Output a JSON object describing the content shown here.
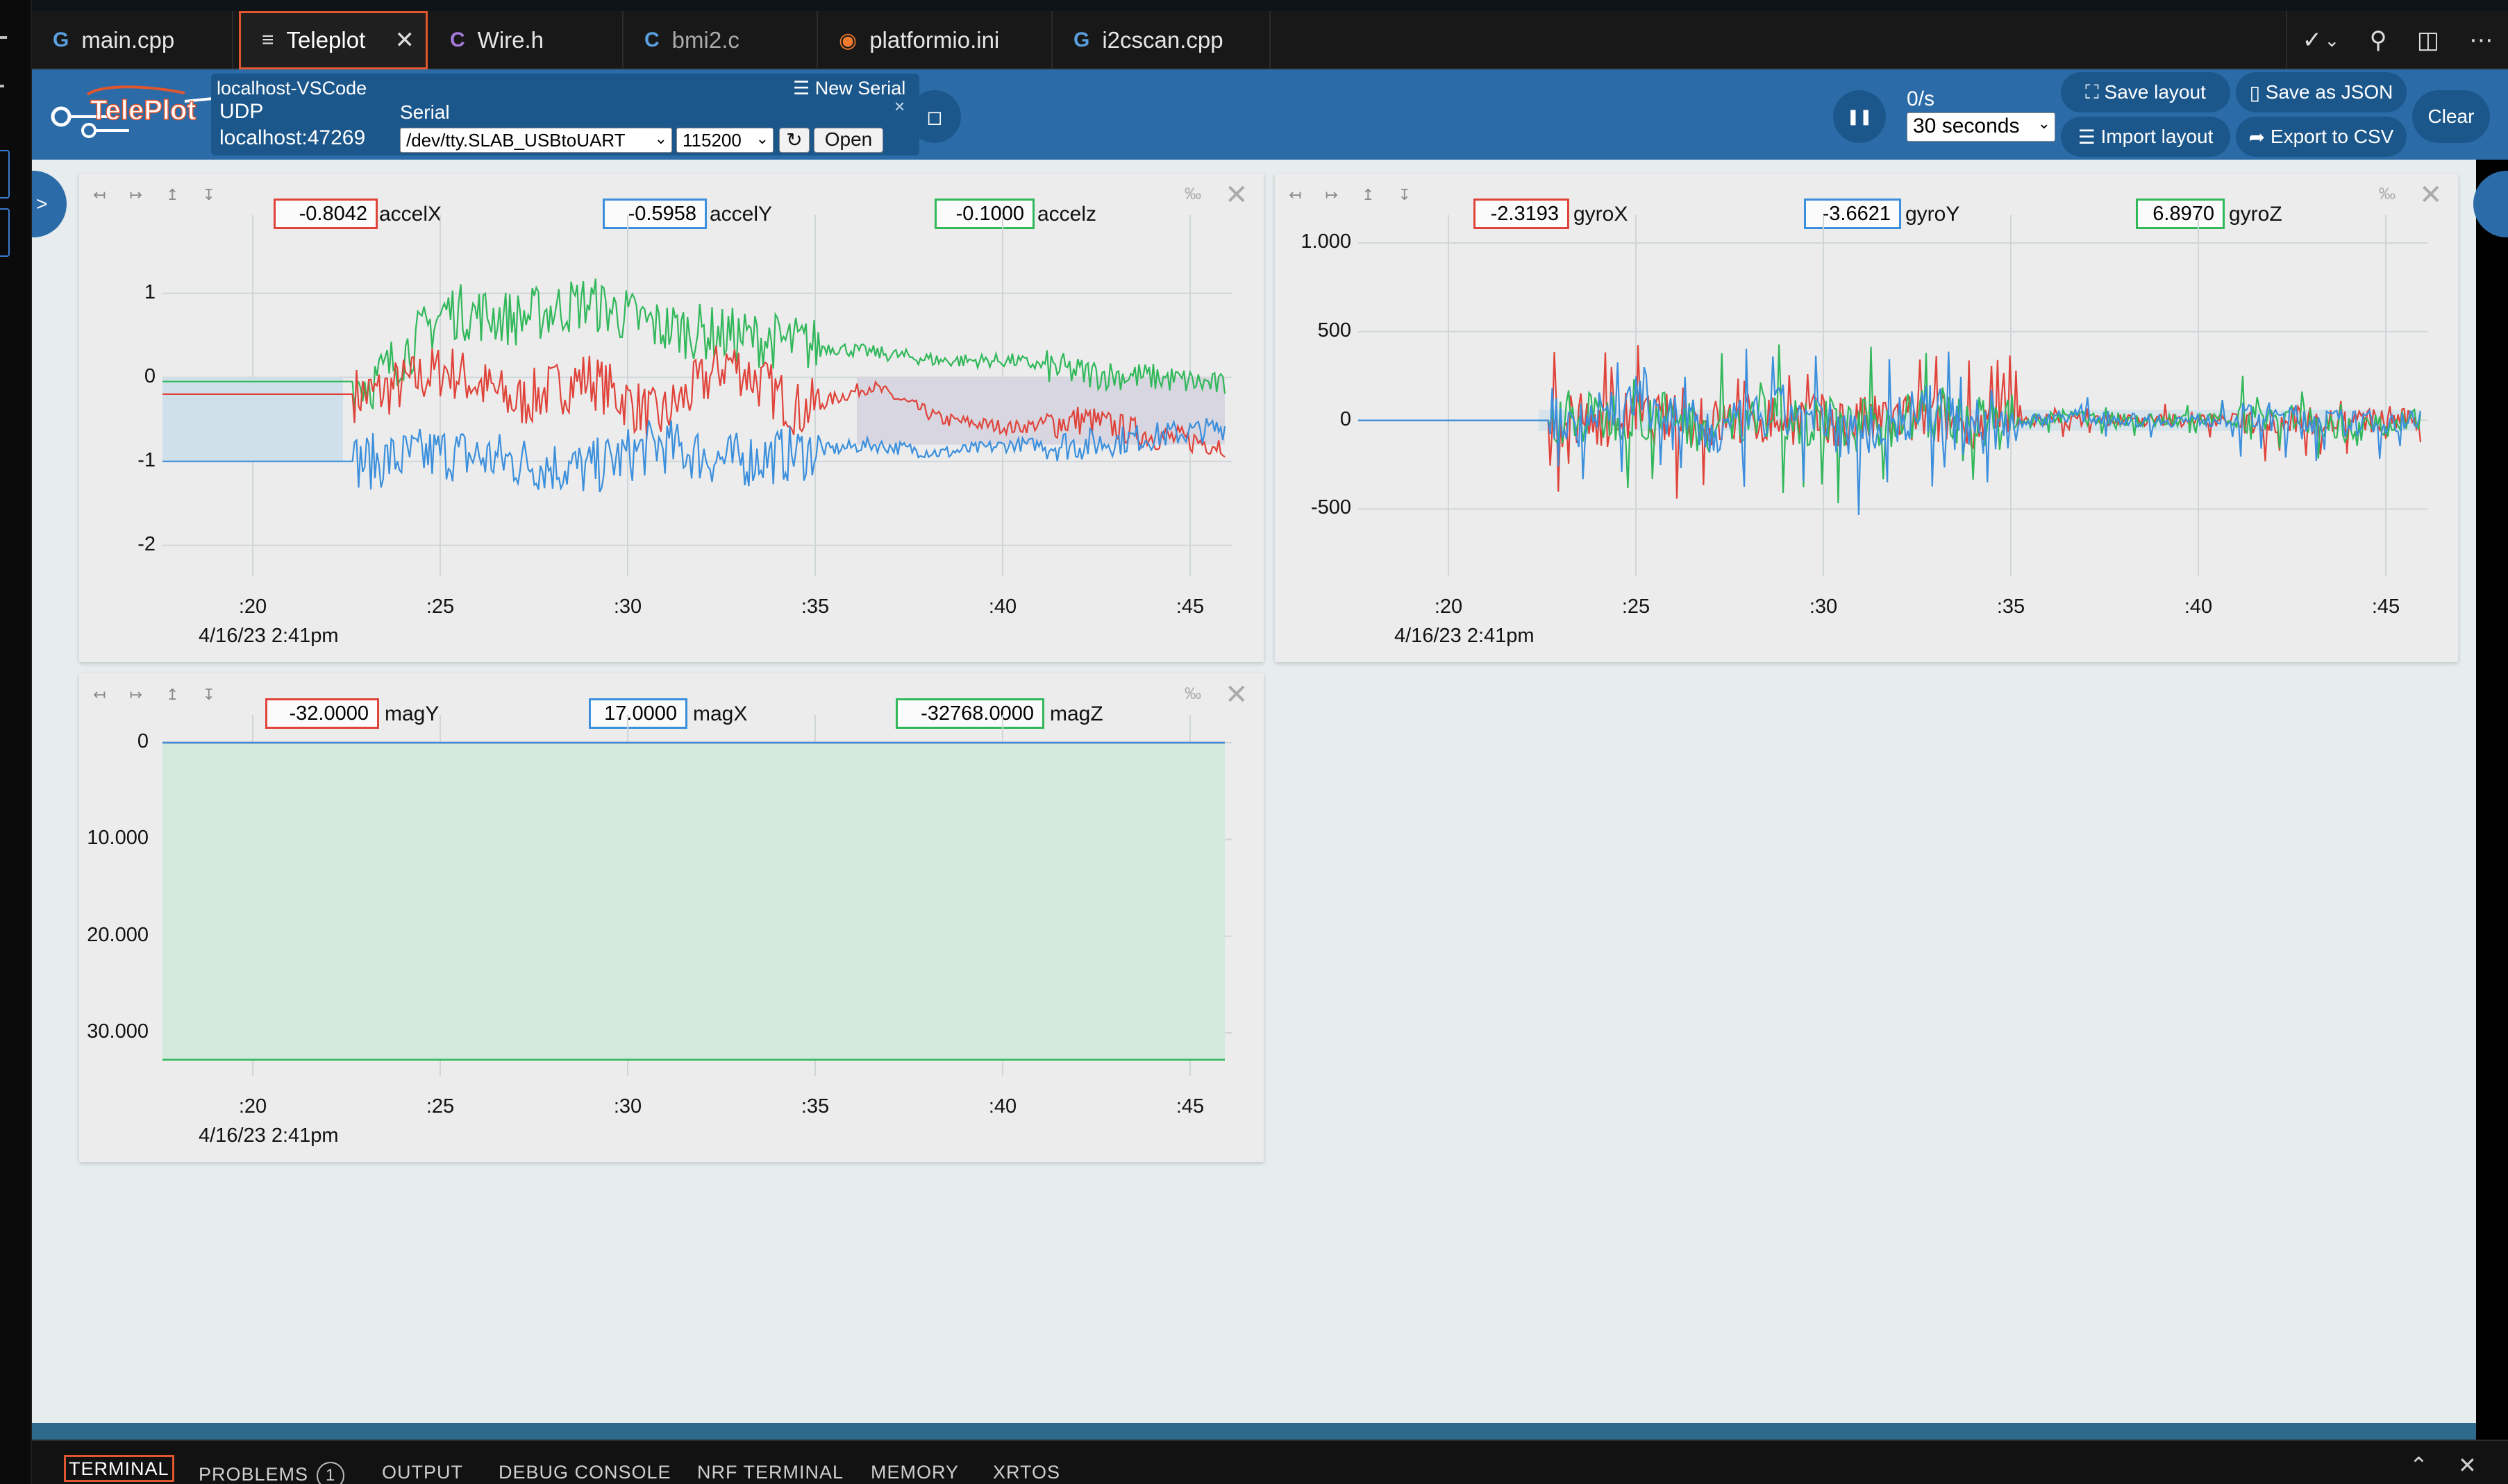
{
  "tabs": [
    {
      "label": "main.cpp",
      "icon": "cpp-file-icon",
      "glyph": "G"
    },
    {
      "label": "Teleplot",
      "icon": "preview-icon",
      "glyph": "≡",
      "active": true
    },
    {
      "label": "Wire.h",
      "icon": "c-header-icon",
      "glyph": "C"
    },
    {
      "label": "bmi2.c",
      "icon": "c-file-icon",
      "glyph": "C"
    },
    {
      "label": "platformio.ini",
      "icon": "platformio-icon",
      "glyph": "◉"
    },
    {
      "label": "i2cscan.cpp",
      "icon": "cpp-file-icon",
      "glyph": "G"
    }
  ],
  "tab_actions": [
    "✓",
    "⌄",
    "⚲",
    "◫",
    "⋯"
  ],
  "logo_text": "TelePlot",
  "connection": {
    "host": "localhost-VSCode",
    "udp_label": "UDP",
    "udp_address": "localhost:47269",
    "new_serial": "New Serial",
    "serial_label": "Serial",
    "port": "/dev/tty.SLAB_USBtoUART",
    "baud": "115200",
    "refresh": "↻",
    "open": "Open",
    "close": "×"
  },
  "controls": {
    "stop_icon": "◻",
    "pause_icon": "❚❚",
    "rate": "0/s",
    "window": "30 seconds",
    "save_layout": "Save layout",
    "import_layout": "Import layout",
    "save_json": "Save as JSON",
    "export_csv": "Export to CSV",
    "clear": "Clear"
  },
  "panel_controls": {
    "tools": "↤ ↦ ↥ ↧",
    "pct": "‰",
    "close": "✕"
  },
  "date_label": "4/16/23 2:41pm",
  "x_ticks": [
    ":20",
    ":25",
    ":30",
    ":35",
    ":40",
    ":45"
  ],
  "colors": {
    "red": "#e0433a",
    "blue": "#3b8fdc",
    "green": "#31b85a"
  },
  "chart_data": [
    {
      "type": "line",
      "series": [
        {
          "name": "accelX",
          "color": "#e0433a",
          "last": "-0.8042",
          "values": [
            -0.2,
            -0.2,
            -0.2,
            -0.2,
            0.1,
            -0.3,
            0.0,
            -0.5,
            0.2,
            -0.4,
            -0.1,
            -0.5,
            -0.6,
            -0.5,
            -0.7,
            -0.8
          ]
        },
        {
          "name": "accelY",
          "color": "#3b8fdc",
          "last": "-0.5958",
          "values": [
            -1.0,
            -1.0,
            -1.0,
            -1.0,
            -0.9,
            -1.0,
            -1.1,
            -0.8,
            -1.0,
            -0.9,
            -0.8,
            -0.9,
            -0.8,
            -0.8,
            -0.7,
            -0.6
          ]
        },
        {
          "name": "accelz",
          "color": "#31b85a",
          "last": "-0.1000",
          "values": [
            -0.05,
            -0.05,
            -0.05,
            -0.05,
            0.8,
            0.7,
            0.9,
            0.6,
            0.5,
            0.4,
            0.3,
            0.2,
            0.2,
            0.05,
            0.0,
            -0.1
          ]
        }
      ],
      "y_ticks": [
        "1",
        "0",
        "-1",
        "-2"
      ],
      "ylim": [
        -2.2,
        1.6
      ]
    },
    {
      "type": "line",
      "series": [
        {
          "name": "gyroX",
          "color": "#e0433a",
          "last": "-2.3193",
          "values": [
            0,
            0,
            0,
            0,
            120,
            -150,
            90,
            -80,
            60,
            -70,
            40,
            0,
            0,
            30,
            -20,
            0
          ]
        },
        {
          "name": "gyroY",
          "color": "#3b8fdc",
          "last": "-3.6621",
          "values": [
            0,
            0,
            0,
            0,
            790,
            -600,
            350,
            -620,
            380,
            -250,
            200,
            0,
            0,
            120,
            -140,
            0
          ]
        },
        {
          "name": "gyroZ",
          "color": "#31b85a",
          "last": "6.8970",
          "values": [
            0,
            0,
            0,
            0,
            300,
            -300,
            250,
            -300,
            280,
            -220,
            160,
            0,
            0,
            180,
            -350,
            0
          ]
        }
      ],
      "y_ticks": [
        "1.000",
        "500",
        "0",
        "-500"
      ],
      "ylim": [
        -800,
        1000
      ]
    },
    {
      "type": "line",
      "series": [
        {
          "name": "magY",
          "color": "#e0433a",
          "last": "-32.0000",
          "values": [
            -32,
            -32,
            -32,
            -32,
            -32,
            -32
          ]
        },
        {
          "name": "magX",
          "color": "#3b8fdc",
          "last": "17.0000",
          "values": [
            17,
            17,
            17,
            17,
            17,
            17
          ]
        },
        {
          "name": "magZ",
          "color": "#31b85a",
          "last": "-32768.0000",
          "values": [
            -32768,
            -32768,
            -32768,
            -32768,
            -32768,
            -32768
          ]
        }
      ],
      "y_ticks": [
        "0",
        "10.000",
        "20.000",
        "30.000"
      ],
      "ylim": [
        -33000,
        0
      ]
    }
  ],
  "bottom_tabs": [
    "TERMINAL",
    "PROBLEMS",
    "OUTPUT",
    "DEBUG CONSOLE",
    "NRF TERMINAL",
    "MEMORY",
    "XRTOS"
  ],
  "problems_count": "1",
  "bottom_actions": [
    "⌃",
    "✕"
  ]
}
